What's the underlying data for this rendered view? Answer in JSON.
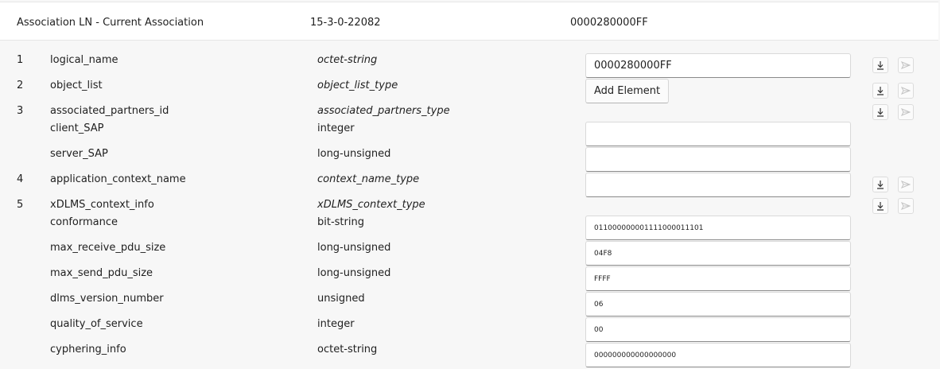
{
  "header": {
    "object_name": "Association LN - Current Association",
    "class_id": "15-3-0-22082",
    "obis": "0000280000FF"
  },
  "attributes": [
    {
      "index": "1",
      "name": "logical_name",
      "type": "octet-string",
      "value": "0000280000FF",
      "actions": true
    },
    {
      "index": "2",
      "name": "object_list",
      "type": "object_list_type",
      "button_label": "Add Element",
      "actions": true
    },
    {
      "index": "3",
      "name": "associated_partners_id",
      "type": "associated_partners_type",
      "actions": true
    },
    {
      "index": "",
      "name": "client_SAP",
      "type": "integer",
      "value": ""
    },
    {
      "index": "",
      "name": "server_SAP",
      "type": "long-unsigned",
      "value": ""
    },
    {
      "index": "4",
      "name": "application_context_name",
      "type": "context_name_type",
      "value": "",
      "actions": true
    },
    {
      "index": "5",
      "name": "xDLMS_context_info",
      "type": "xDLMS_context_type",
      "actions": true
    },
    {
      "index": "",
      "name": "conformance",
      "type": "bit-string",
      "value": "011000000001111000011101"
    },
    {
      "index": "",
      "name": "max_receive_pdu_size",
      "type": "long-unsigned",
      "value": "04F8"
    },
    {
      "index": "",
      "name": "max_send_pdu_size",
      "type": "long-unsigned",
      "value": "FFFF"
    },
    {
      "index": "",
      "name": "dlms_version_number",
      "type": "unsigned",
      "value": "06"
    },
    {
      "index": "",
      "name": "quality_of_service",
      "type": "integer",
      "value": "00"
    },
    {
      "index": "",
      "name": "cyphering_info",
      "type": "octet-string",
      "value": "000000000000000000"
    }
  ],
  "icons": {
    "read": "download-icon",
    "write": "send-icon"
  },
  "colors": {
    "background": "#f7f7f7",
    "header_background": "#ffffff",
    "field_border": "#d9d9d9",
    "disabled_icon": "#c4c4c4"
  }
}
